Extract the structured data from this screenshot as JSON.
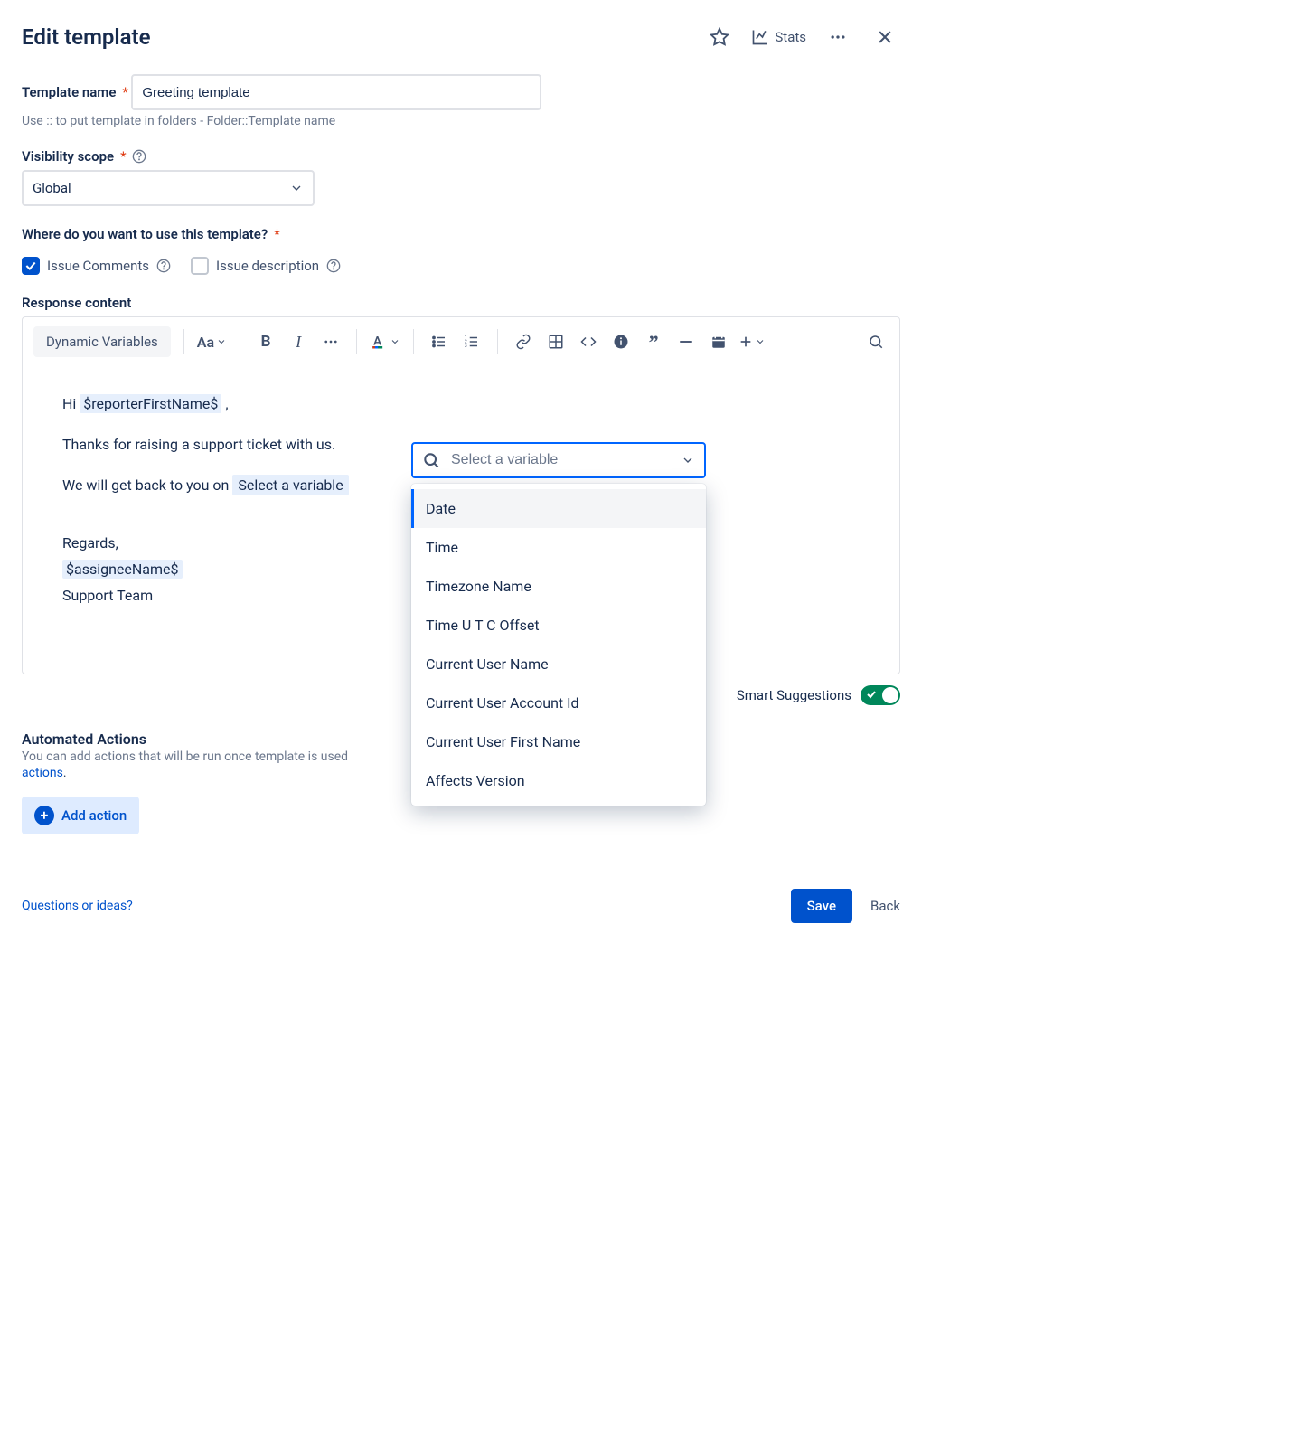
{
  "header": {
    "title": "Edit template",
    "stats_label": "Stats"
  },
  "fields": {
    "name_label": "Template name",
    "name_value": "Greeting template",
    "name_hint": "Use :: to put template in folders - Folder::Template name",
    "scope_label": "Visibility scope",
    "scope_value": "Global",
    "usage_label": "Where do you want to use this template?",
    "usage_options": {
      "comments_label": "Issue Comments",
      "description_label": "Issue description"
    },
    "response_label": "Response content"
  },
  "toolbar": {
    "dyn_var": "Dynamic Variables",
    "text_style": "Aa"
  },
  "content": {
    "greeting_prefix": "Hi ",
    "greeting_var": "$reporterFirstName$",
    "greeting_suffix": " ,",
    "line2": "Thanks for raising a support ticket with us.",
    "line3_prefix": "We will get back to you on ",
    "line3_chip": "Select a variable",
    "regards": "Regards,",
    "assignee_var": "$assigneeName$",
    "team": "Support Team"
  },
  "dropdown": {
    "placeholder": "Select a variable",
    "items": [
      "Date",
      "Time",
      "Timezone Name",
      "Time U T C Offset",
      "Current User Name",
      "Current User Account Id",
      "Current User First Name",
      "Affects Version"
    ]
  },
  "smart": {
    "label": "Smart Suggestions"
  },
  "actions": {
    "title": "Automated Actions",
    "desc_prefix": "You can add actions that will be run once template is used",
    "desc_link": "actions",
    "desc_suffix": ".",
    "add_label": "Add action"
  },
  "footer": {
    "questions": "Questions or ideas?",
    "save": "Save",
    "back": "Back"
  }
}
